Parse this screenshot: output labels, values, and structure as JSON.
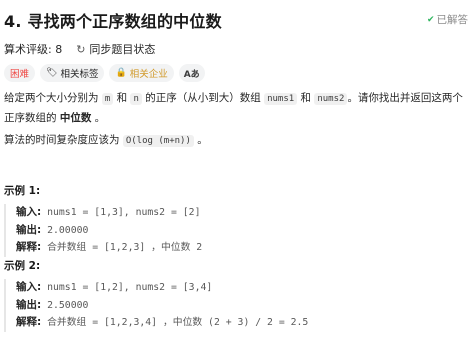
{
  "problem": {
    "title": "4. 寻找两个正序数组的中位数",
    "solved_label": "已解答",
    "rating_label": "算术评级: 8",
    "sync_label": "同步题目状态"
  },
  "tags": {
    "difficulty": "困难",
    "topics": "相关标签",
    "companies": "相关企业",
    "lang": "Aあ"
  },
  "description": {
    "p1_a": "给定两个大小分别为 ",
    "p1_m": "m",
    "p1_b": " 和 ",
    "p1_n": "n",
    "p1_c": " 的正序（从小到大）数组 ",
    "p1_nums1": "nums1",
    "p1_d": " 和 ",
    "p1_nums2": "nums2",
    "p1_e": "。请你找出并返回这两个正序数组的 ",
    "p1_bold": "中位数",
    "p1_f": " 。",
    "p2_a": "算法的时间复杂度应该为 ",
    "p2_code": "O(log (m+n))",
    "p2_b": " 。"
  },
  "examples": [
    {
      "title": "示例 1:",
      "input_label": "输入:",
      "input_value": "nums1 = [1,3], nums2 = [2]",
      "output_label": "输出:",
      "output_value": "2.00000",
      "explain_label": "解释:",
      "explain_value": "合并数组 = [1,2,3] ，中位数 2"
    },
    {
      "title": "示例 2:",
      "input_label": "输入:",
      "input_value": "nums1 = [1,2], nums2 = [3,4]",
      "output_label": "输出:",
      "output_value": "2.50000",
      "explain_label": "解释:",
      "explain_value": "合并数组 = [1,2,3,4] ，中位数 (2 + 3) / 2 = 2.5"
    }
  ],
  "colors": {
    "hard": "#ef4743",
    "company": "#d19a2a",
    "solved_check": "#2db55d"
  }
}
